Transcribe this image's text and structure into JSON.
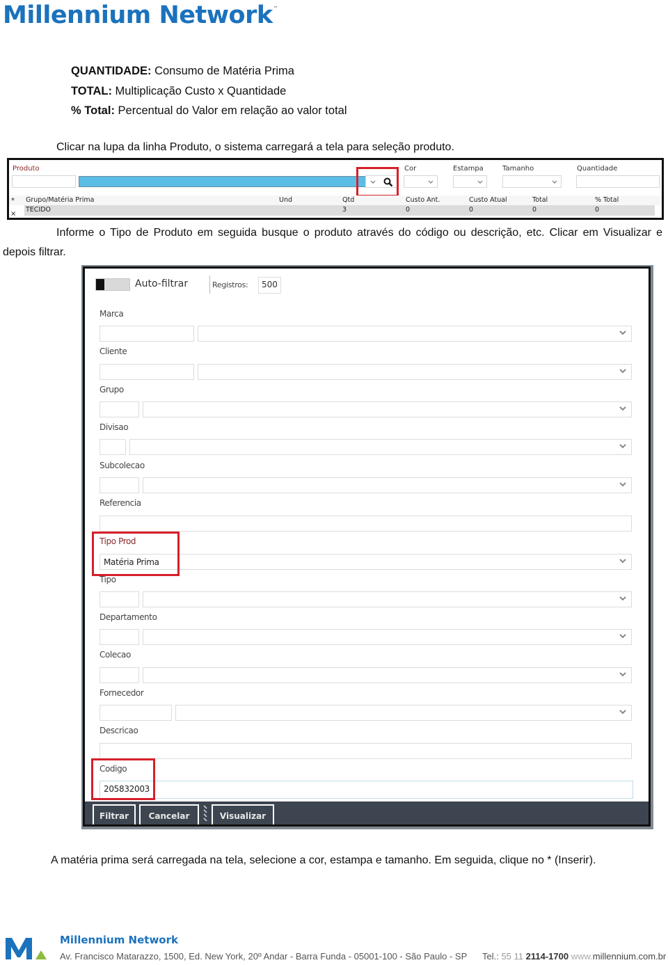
{
  "header": {
    "brand": "Millennium Network",
    "trademark": "™"
  },
  "definitions": [
    {
      "term": "QUANTIDADE:",
      "desc": " Consumo de Matéria Prima"
    },
    {
      "term": "TOTAL:",
      "desc": " Multiplicação Custo x Quantidade"
    },
    {
      "term": "% Total:",
      "desc": " Percentual do Valor em relação ao valor total"
    }
  ],
  "paragraphs": {
    "p1": "Clicar na lupa da linha Produto, o sistema carregará a tela para seleção produto.",
    "p2": "Informe o Tipo de Produto em seguida busque o produto através do código ou descrição, etc. Clicar em Visualizar e depois filtrar.",
    "p3": "A matéria prima será carregada na tela, selecione a cor, estampa e tamanho. Em seguida, clique no * (Inserir)."
  },
  "product_grid": {
    "fields": {
      "produto": "Produto",
      "cor": "Cor",
      "estampa": "Estampa",
      "tamanho": "Tamanho",
      "quantidade": "Quantidade"
    },
    "columns": [
      "Grupo/Matéria Prima",
      "Und",
      "Qtd",
      "Custo Ant.",
      "Custo Atual",
      "Total",
      "% Total"
    ],
    "rows": [
      [
        "TECIDO",
        "",
        "3",
        "0",
        "0",
        "0",
        "0"
      ]
    ],
    "insert_mark": "*",
    "delete_mark": "×"
  },
  "filter_dialog": {
    "auto_filter_label": "Auto-filtrar",
    "records_label": "Registros:",
    "records_value": "500",
    "fields": [
      {
        "label": "Marca",
        "value": ""
      },
      {
        "label": "Cliente",
        "value": ""
      },
      {
        "label": "Grupo",
        "value": ""
      },
      {
        "label": "Divisao",
        "value": ""
      },
      {
        "label": "Subcolecao",
        "value": ""
      },
      {
        "label": "Referencia",
        "value": ""
      },
      {
        "label": "Tipo Prod",
        "value": "Matéria Prima"
      },
      {
        "label": "Tipo",
        "value": ""
      },
      {
        "label": "Departamento",
        "value": ""
      },
      {
        "label": "Colecao",
        "value": ""
      },
      {
        "label": "Fornecedor",
        "value": ""
      },
      {
        "label": "Descricao",
        "value": ""
      },
      {
        "label": "Codigo",
        "value": "205832003"
      }
    ],
    "buttons": {
      "filtrar": "Filtrar",
      "cancelar": "Cancelar",
      "visualizar": "Visualizar"
    }
  },
  "footer": {
    "company": "Millennium Network",
    "address": "Av. Francisco Matarazzo, 1500, Ed. New York, 20º Andar  - Barra Funda - 05001-100 - São Paulo - SP",
    "tel_label": "Tel.:",
    "tel_prefix": " 55 11 ",
    "tel_number": "2114-1700",
    "web_prefix": " www.",
    "web_domain": "millennium.com.br"
  },
  "colors": {
    "brand_blue": "#1b72bd",
    "highlight_red": "#d6202a",
    "selected_field_blue": "#5bbde6",
    "dialog_footer": "#3d4550",
    "logo_green": "#8dbb3c"
  }
}
